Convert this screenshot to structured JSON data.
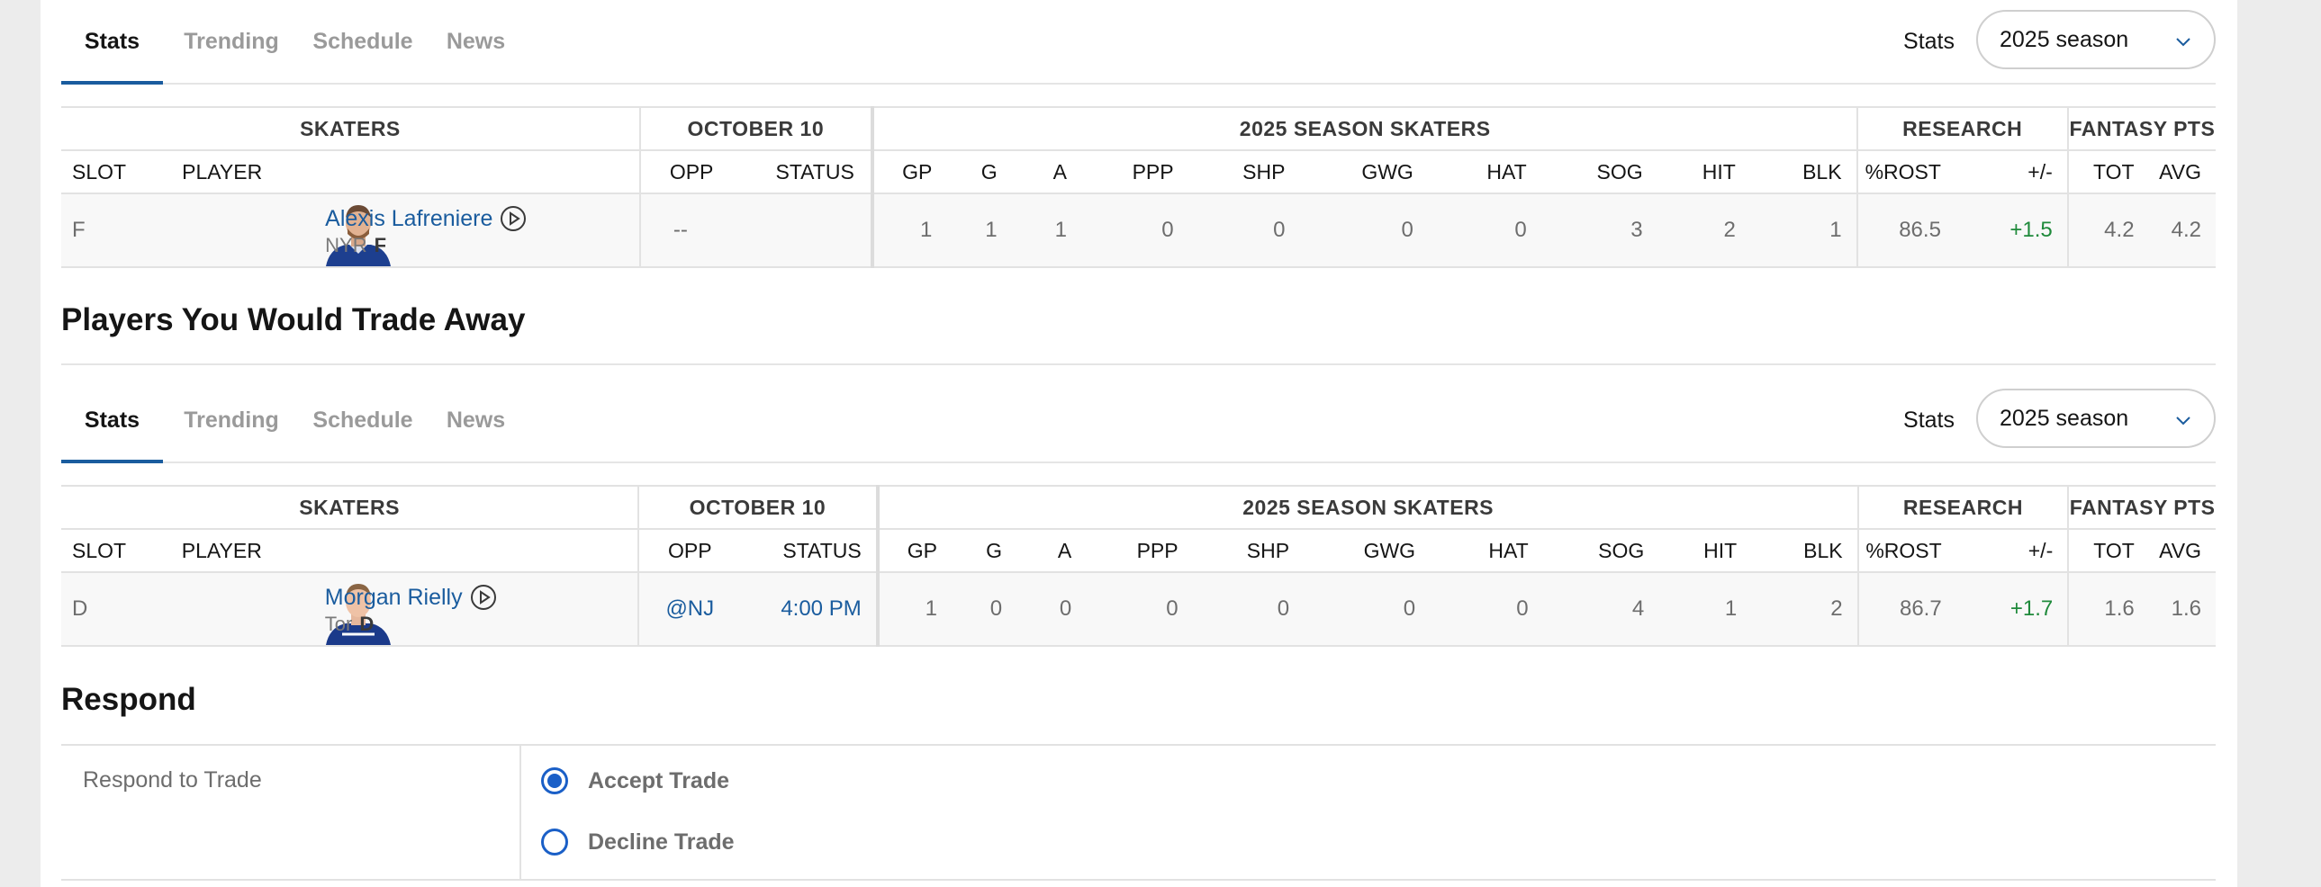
{
  "sections": {
    "trade_away_title": "Players You Would Trade Away",
    "respond_title": "Respond"
  },
  "tabs": [
    "Stats",
    "Trending",
    "Schedule",
    "News"
  ],
  "stats_select": {
    "label": "Stats",
    "value": "2025 season"
  },
  "table": {
    "groups": {
      "skaters": "SKATERS",
      "date": "OCTOBER 10",
      "season": "2025 SEASON SKATERS",
      "research": "RESEARCH",
      "fantasy": "FANTASY PTS"
    },
    "columns": {
      "slot": "SLOT",
      "player": "PLAYER",
      "opp": "OPP",
      "status": "STATUS",
      "gp": "GP",
      "g": "G",
      "a": "A",
      "ppp": "PPP",
      "shp": "SHP",
      "gwg": "GWG",
      "hat": "HAT",
      "sog": "SOG",
      "hit": "HIT",
      "blk": "BLK",
      "rost": "%ROST",
      "pm": "+/-",
      "tot": "TOT",
      "avg": "AVG"
    }
  },
  "acquire_row": {
    "slot": "F",
    "name": "Alexis Lafreniere",
    "team": "NYR",
    "pos": "F",
    "opp": "--",
    "status": "",
    "gp": "1",
    "g": "1",
    "a": "1",
    "ppp": "0",
    "shp": "0",
    "gwg": "0",
    "hat": "0",
    "sog": "3",
    "hit": "2",
    "blk": "1",
    "rost": "86.5",
    "pm": "+1.5",
    "tot": "4.2",
    "avg": "4.2",
    "jersey_color": "#1d3f8f"
  },
  "trade_row": {
    "slot": "D",
    "name": "Morgan Rielly",
    "team": "Tor",
    "pos": "D",
    "opp": "@NJ",
    "status": "4:00 PM",
    "gp": "1",
    "g": "0",
    "a": "0",
    "ppp": "0",
    "shp": "0",
    "gwg": "0",
    "hat": "0",
    "sog": "4",
    "hit": "1",
    "blk": "2",
    "rost": "86.7",
    "pm": "+1.7",
    "tot": "1.6",
    "avg": "1.6",
    "jersey_color": "#1b3a8a"
  },
  "respond": {
    "label": "Respond to Trade",
    "options": [
      {
        "label": "Accept Trade",
        "checked": true
      },
      {
        "label": "Decline Trade",
        "checked": false
      }
    ]
  },
  "colors": {
    "accent": "#1a5c9e",
    "positive": "#1f8a3b",
    "radio": "#1a5fc7"
  },
  "icons": {
    "select": "chevron-down-icon",
    "play": "play-circle-icon"
  }
}
